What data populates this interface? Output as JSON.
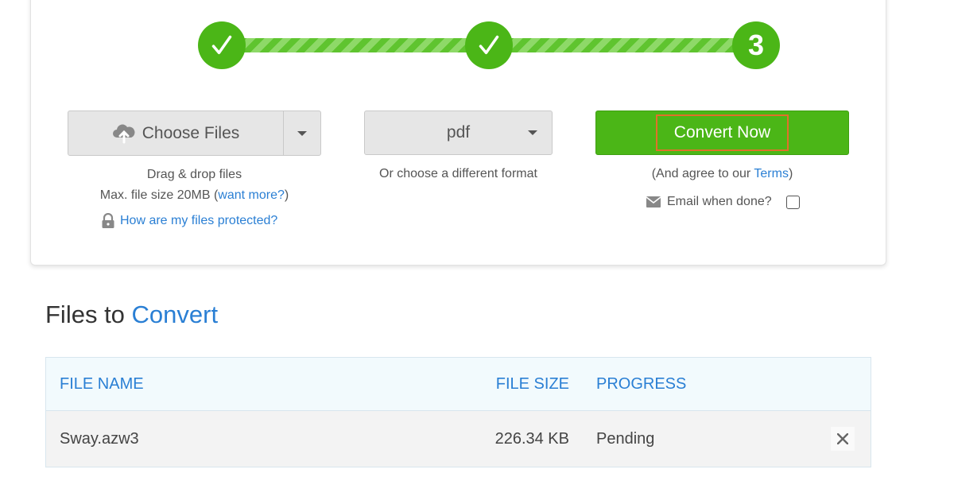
{
  "steps": [
    {
      "label": "",
      "state": "done"
    },
    {
      "label": "",
      "state": "done"
    },
    {
      "label": "3",
      "state": "current"
    }
  ],
  "upload": {
    "choose_files_label": "Choose Files",
    "drag_text": "Drag & drop files",
    "max_size_prefix": "Max. file size 20MB (",
    "want_more_link": "want more?",
    "max_size_suffix": ")",
    "protect_link": "How are my files protected?"
  },
  "format": {
    "selected": "pdf",
    "hint": "Or choose a different format"
  },
  "convert": {
    "button_label": "Convert Now",
    "agree_prefix": "(And agree to our ",
    "terms_link": "Terms",
    "agree_suffix": ")",
    "email_label": "Email when done?"
  },
  "files_section": {
    "title_prefix": "Files to ",
    "title_accent": "Convert",
    "columns": {
      "name": "FILE NAME",
      "size": "FILE SIZE",
      "progress": "PROGRESS"
    },
    "rows": [
      {
        "name": "Sway.azw3",
        "size": "226.34 KB",
        "progress": "Pending"
      }
    ]
  },
  "colors": {
    "green": "#4bb617",
    "link_blue": "#2a7fd4",
    "highlight_orange": "#e0702a"
  }
}
